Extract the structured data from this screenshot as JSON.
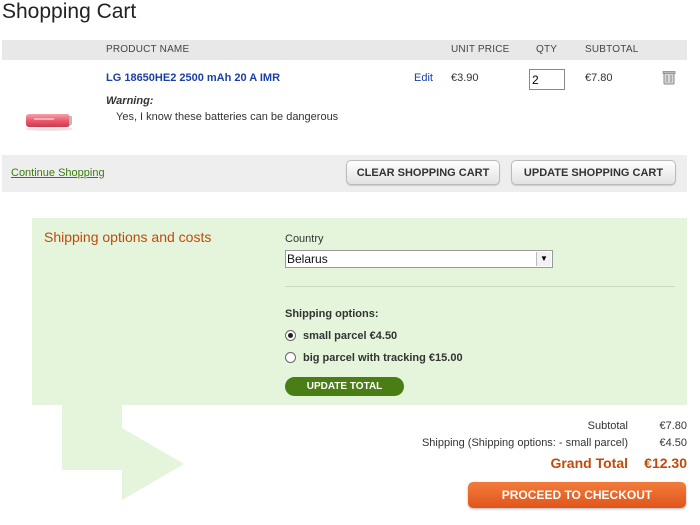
{
  "page": {
    "title": "Shopping Cart"
  },
  "table": {
    "headers": {
      "product_name": "PRODUCT NAME",
      "unit_price": "UNIT PRICE",
      "qty": "QTY",
      "subtotal": "SUBTOTAL"
    }
  },
  "item": {
    "name": "LG 18650HE2 2500 mAh 20 A IMR",
    "warning_label": "Warning:",
    "warning_text": "Yes, I know these batteries can be dangerous",
    "edit_label": "Edit",
    "unit_price": "€3.90",
    "qty": "2",
    "subtotal": "€7.80",
    "battery_color": "#ef5a6e",
    "icons": {
      "trash": "trash-icon"
    }
  },
  "actions": {
    "continue_label": "Continue Shopping",
    "clear_label": "CLEAR SHOPPING CART",
    "update_label": "UPDATE SHOPPING CART"
  },
  "shipping": {
    "title": "Shipping options and costs",
    "country_label": "Country",
    "country_value": "Belarus",
    "options_label": "Shipping options:",
    "options": [
      {
        "label": "small parcel €4.50",
        "checked": true
      },
      {
        "label": "big parcel with tracking €15.00",
        "checked": false
      }
    ],
    "update_total_label": "UPDATE TOTAL",
    "box_color": "#e4f5db"
  },
  "totals": {
    "subtotal_label": "Subtotal",
    "subtotal_value": "€7.80",
    "shipping_label": "Shipping (Shipping options: - small parcel)",
    "shipping_value": "€4.50",
    "grand_label": "Grand Total",
    "grand_value": "€12.30",
    "checkout_label": "PROCEED TO CHECKOUT",
    "accent_color": "#c04a0c"
  }
}
